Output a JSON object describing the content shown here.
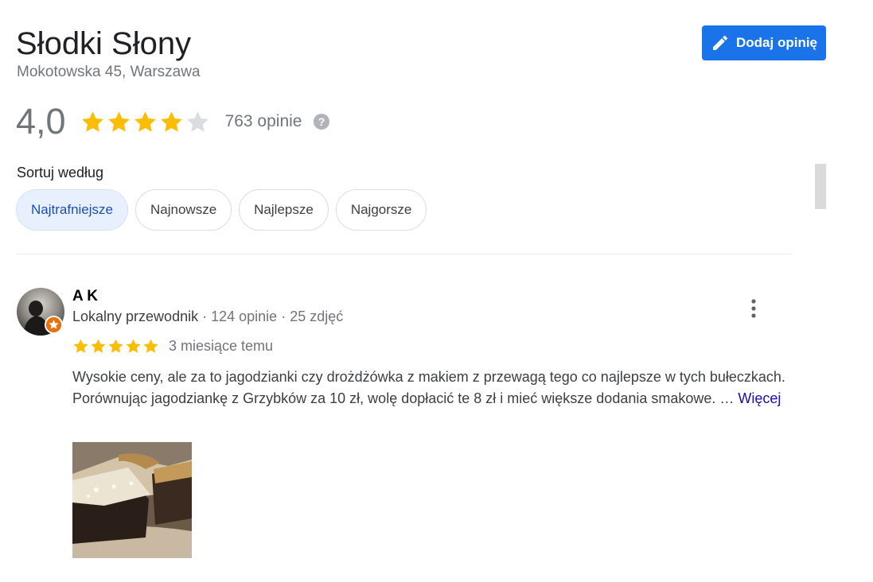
{
  "place": {
    "name": "Słodki Słony",
    "address": "Mokotowska 45, Warszawa"
  },
  "add_review_button": {
    "label": "Dodaj opinię",
    "icon": "pencil-icon"
  },
  "summary": {
    "rating": "4,0",
    "stars_filled": 4,
    "stars_total": 5,
    "review_count": "763 opinie"
  },
  "sort": {
    "label": "Sortuj według",
    "options": [
      "Najtrafniejsze",
      "Najnowsze",
      "Najlepsze",
      "Najgorsze"
    ],
    "selected": "Najtrafniejsze"
  },
  "reviews": [
    {
      "author": "A K",
      "guide_label": "Lokalny przewodnik",
      "reviews_count": "124 opinie",
      "photos_count": "25 zdjęć",
      "stars": 5,
      "time": "3 miesiące temu",
      "text": "Wysokie ceny, ale za to jagodzianki czy drożdżówka z makiem z przewagą tego co najlepsze w tych bułeczkach. Porównując jagodziankę z Grzybków za 10 zł, wolę dopłacić te 8 zł i mieć większe dodania smakowe. …",
      "more_link": "Więcej"
    }
  ],
  "colors": {
    "accent": "#1a73e8",
    "star": "#fbbc04",
    "star_empty": "#dadce0",
    "guide_badge": "#e8710a"
  }
}
